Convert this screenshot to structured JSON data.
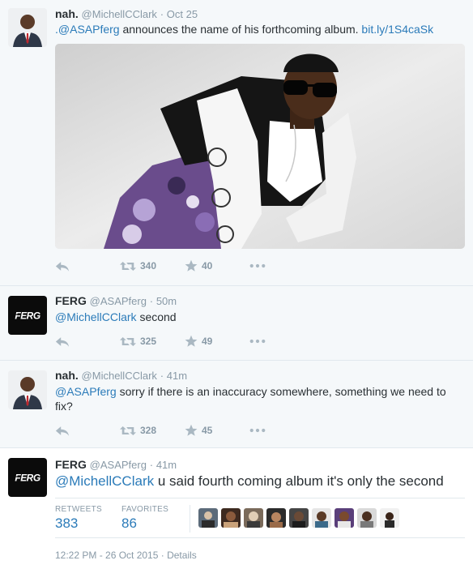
{
  "tweets": [
    {
      "name": "nah.",
      "handle": "@MichellCClark",
      "dot": "·",
      "time": "Oct 25",
      "text_mention": ".@ASAPferg",
      "text_body": " announces the name of his forthcoming album. ",
      "text_link": "bit.ly/1S4caSk",
      "retweets": "340",
      "favorites": "40"
    },
    {
      "name": "FERG",
      "handle": "@ASAPferg",
      "dot": "·",
      "time": "50m",
      "text_mention": "@MichellCClark",
      "text_body": " second",
      "retweets": "325",
      "favorites": "49"
    },
    {
      "name": "nah.",
      "handle": "@MichellCClark",
      "dot": "·",
      "time": "41m",
      "text_mention": "@ASAPferg",
      "text_body": " sorry if there is an inaccuracy somewhere, something we need to fix?",
      "retweets": "328",
      "favorites": "45"
    },
    {
      "name": "FERG",
      "handle": "@ASAPferg",
      "dot": "·",
      "time": "41m",
      "text_mention": "@MichellCClark",
      "text_body": " u said fourth coming album it's only the second"
    }
  ],
  "logo_text": "FERG",
  "stats": {
    "retweets_label": "RETWEETS",
    "retweets_value": "383",
    "favorites_label": "FAVORITES",
    "favorites_value": "86"
  },
  "meta": {
    "datetime": "12:22 PM - 26 Oct 2015",
    "dot": "·",
    "details": "Details"
  },
  "colors": {
    "link": "#2b7bb9",
    "muted": "#8899a6",
    "icon": "#aab8c2",
    "context_background": "#f5f8fa"
  }
}
